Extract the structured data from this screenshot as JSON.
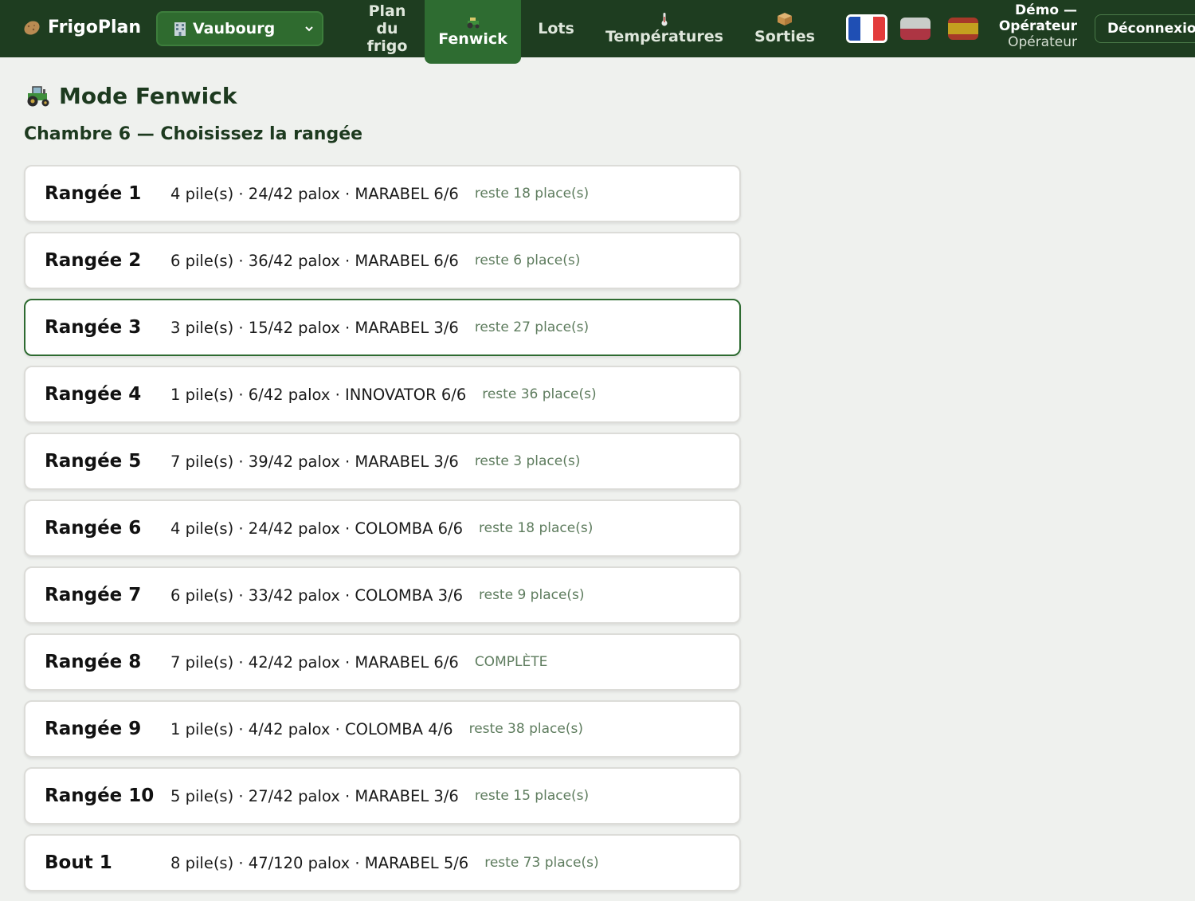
{
  "app": {
    "name": "FrigoPlan"
  },
  "site_select": {
    "value": "Vaubourg"
  },
  "nav": {
    "plan_line1": "Plan",
    "plan_line2": "du",
    "plan_line3": "frigo",
    "fenwick": "Fenwick",
    "lots": "Lots",
    "temperatures": "Températures",
    "sorties": "Sorties"
  },
  "languages": [
    "fr",
    "pl",
    "es"
  ],
  "user": {
    "name_line1": "Démo —",
    "name_line2": "Opérateur",
    "role": "Opérateur"
  },
  "logout_label": "Déconnexion",
  "page": {
    "title": "Mode Fenwick",
    "subtitle": "Chambre 6 — Choisissez la rangée"
  },
  "rows": [
    {
      "name": "Rangée 1",
      "info": "4 pile(s) · 24/42 palox · MARABEL 6/6",
      "rest": "reste 18 place(s)"
    },
    {
      "name": "Rangée 2",
      "info": "6 pile(s) · 36/42 palox · MARABEL 6/6",
      "rest": "reste 6 place(s)"
    },
    {
      "name": "Rangée 3",
      "info": "3 pile(s) · 15/42 palox · MARABEL 3/6",
      "rest": "reste 27 place(s)"
    },
    {
      "name": "Rangée 4",
      "info": "1 pile(s) · 6/42 palox · INNOVATOR 6/6",
      "rest": "reste 36 place(s)"
    },
    {
      "name": "Rangée 5",
      "info": "7 pile(s) · 39/42 palox · MARABEL 3/6",
      "rest": "reste 3 place(s)"
    },
    {
      "name": "Rangée 6",
      "info": "4 pile(s) · 24/42 palox · COLOMBA 6/6",
      "rest": "reste 18 place(s)"
    },
    {
      "name": "Rangée 7",
      "info": "6 pile(s) · 33/42 palox · COLOMBA 3/6",
      "rest": "reste 9 place(s)"
    },
    {
      "name": "Rangée 8",
      "info": "7 pile(s) · 42/42 palox · MARABEL 6/6",
      "rest": "COMPLÈTE"
    },
    {
      "name": "Rangée 9",
      "info": "1 pile(s) · 4/42 palox · COLOMBA 4/6",
      "rest": "reste 38 place(s)"
    },
    {
      "name": "Rangée 10",
      "info": "5 pile(s) · 27/42 palox · MARABEL 3/6",
      "rest": "reste 15 place(s)"
    },
    {
      "name": "Bout 1",
      "info": "8 pile(s) · 47/120 palox · MARABEL 5/6",
      "rest": "reste 73 place(s)"
    }
  ],
  "colors": {
    "topbar": "#1e3d20",
    "accent": "#2e6c31",
    "selected_border": "#2e6b31"
  }
}
